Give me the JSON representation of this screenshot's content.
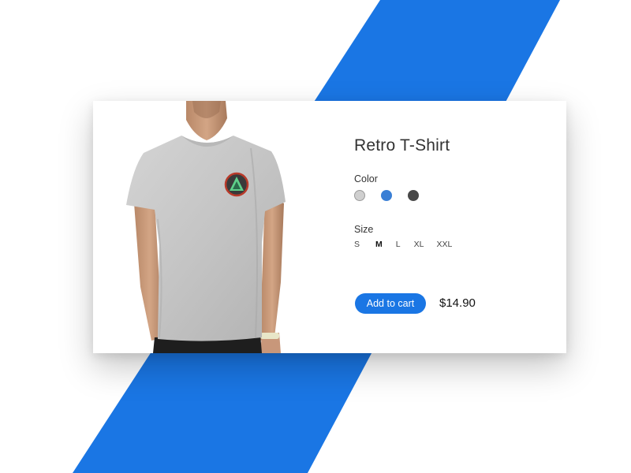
{
  "theme": {
    "accent": "#1a76e4",
    "background": "#ffffff"
  },
  "product": {
    "image_icon": "tshirt-photo",
    "title": "Retro T-Shirt",
    "color_label": "Color",
    "colors": [
      {
        "name": "light-gray",
        "hex": "#cfcfcf"
      },
      {
        "name": "blue",
        "hex": "#3a7fd5"
      },
      {
        "name": "charcoal",
        "hex": "#484848"
      }
    ],
    "size_label": "Size",
    "sizes": [
      "S",
      "M",
      "L",
      "XL",
      "XXL"
    ],
    "selected_size": "M",
    "add_to_cart_label": "Add to cart",
    "price": "$14.90"
  }
}
